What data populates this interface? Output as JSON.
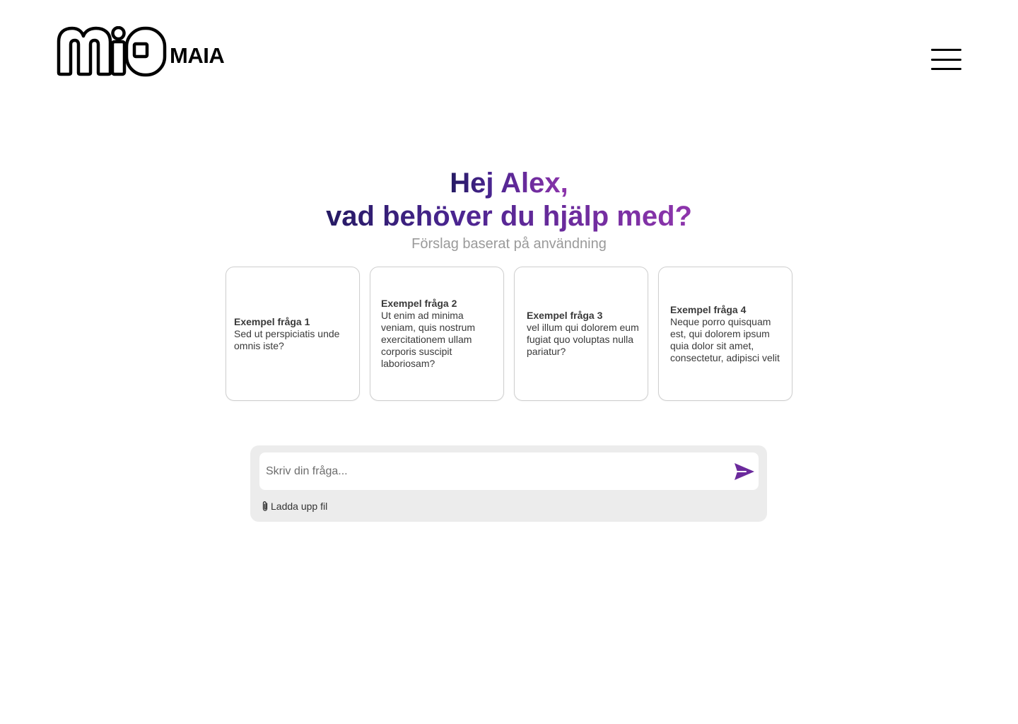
{
  "header": {
    "logo_text": "MAIA",
    "logo_icon": "mio-logo",
    "menu_icon": "hamburger-menu-icon"
  },
  "hero": {
    "greeting": "Hej Alex,",
    "question": "vad behöver du hjälp med?",
    "subtitle": "Förslag baserat på användning",
    "gradient_colors": [
      "#251a63",
      "#4a2590",
      "#6a2b9c",
      "#8e35ac"
    ]
  },
  "suggestions": [
    {
      "title": "Exempel fråga 1",
      "body": "Sed ut perspiciatis unde omnis iste?"
    },
    {
      "title": "Exempel fråga 2",
      "body": "Ut enim ad minima veniam, quis nostrum exercitationem ullam corporis suscipit laboriosam?"
    },
    {
      "title": "Exempel fråga 3",
      "body": "vel illum qui dolorem eum fugiat quo voluptas nulla pariatur?"
    },
    {
      "title": "Exempel fråga 4",
      "body": "Neque porro quisquam est, qui dolorem ipsum quia dolor sit amet, consectetur, adipisci velit"
    }
  ],
  "composer": {
    "placeholder": "Skriv din fråga...",
    "value": "",
    "send_icon": "send-icon",
    "send_color": "#6b2a9c",
    "upload_label": "Ladda upp fil",
    "upload_icon": "paperclip-icon"
  }
}
